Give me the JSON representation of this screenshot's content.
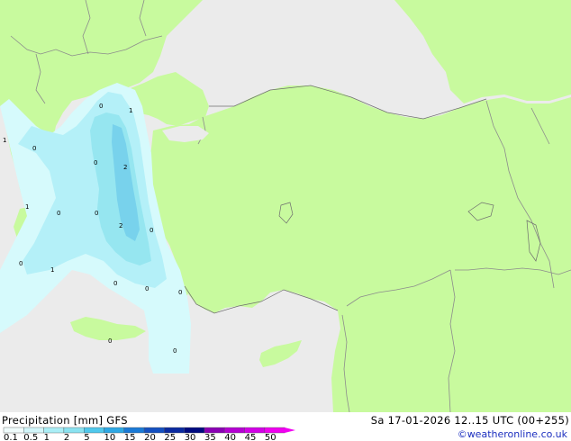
{
  "map": {
    "colors": {
      "sea": "#ebebeb",
      "land": "#c8fa9e",
      "border": "#8c8c8c",
      "coast": "#6e6e6e",
      "precip_trace": "#d6fafc",
      "precip_light": "#b4f0f8",
      "precip_medium": "#96e6f0",
      "precip_heavy": "#78d2ec"
    },
    "field_labels": [
      "0",
      "1",
      "0",
      "1",
      "0",
      "2",
      "1",
      "0",
      "2",
      "0",
      "0",
      "1",
      "0",
      "0",
      "0",
      "0",
      "0",
      "0"
    ]
  },
  "bottom": {
    "product_label": "Precipitation [mm]  GFS",
    "datetime_label": "Sa 17-01-2026 12..15 UTC (00+255)",
    "credit": "©weatheronline.co.uk"
  },
  "legend": {
    "ticks": [
      "0.1",
      "0.5",
      "1",
      "2",
      "5",
      "10",
      "15",
      "20",
      "25",
      "30",
      "35",
      "40",
      "45",
      "50"
    ],
    "colors": [
      "#f0fcfc",
      "#d2f6fa",
      "#aaeef6",
      "#8ae2f0",
      "#50c8ec",
      "#2ea8e4",
      "#1a7ad6",
      "#1450c0",
      "#0a2aa0",
      "#000a80",
      "#8a00b4",
      "#b400d2",
      "#d200e6",
      "#f000f0"
    ]
  }
}
